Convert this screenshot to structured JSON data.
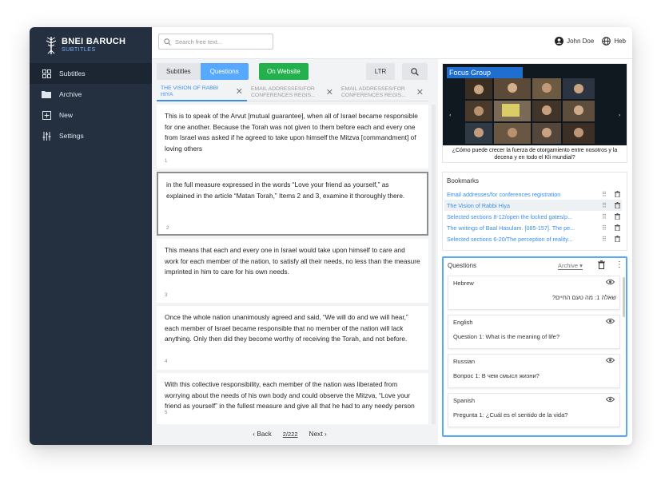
{
  "brand": {
    "name": "BNEI BARUCH",
    "sub": "SUBTITLES"
  },
  "nav": [
    {
      "label": "Subtitles",
      "icon": "grid-icon"
    },
    {
      "label": "Archive",
      "icon": "folder-icon"
    },
    {
      "label": "New",
      "icon": "add-box-icon"
    },
    {
      "label": "Settings",
      "icon": "sliders-icon"
    }
  ],
  "topbar": {
    "search_placeholder": "Search free text...",
    "user": "John Doe",
    "language": "Heb"
  },
  "toolbar": {
    "subtitles": "Subtitles",
    "questions": "Questions",
    "website": "On Website",
    "ltr": "LTR"
  },
  "tabs": [
    {
      "label": "THE VISION OF RABBI HIYA"
    },
    {
      "label": "EMAIL ADDRESSES/FOR CONFERENCES REGIS..."
    },
    {
      "label": "EMAIL ADDRESSES/FOR CONFERENCES REGIS..."
    }
  ],
  "cards": [
    {
      "text": "This is to speak of the Arvut [mutual guarantee], when all of Israel became responsible for one another. Because the Torah was not given to them before each and every one from Israel was asked if he agreed to take upon himself the Mitzva [commandment] of loving others",
      "num": "1"
    },
    {
      "text": "in the full measure expressed in the words “Love your friend as yourself,” as explained in the article “Matan Torah,” Items 2 and 3, examine it thoroughly there.",
      "num": "2"
    },
    {
      "text": "This means that each and every one in Israel would take upon himself to care and work for each member of the nation, to satisfy all their needs, no less than the measure imprinted in him to care for his own needs.",
      "num": "3"
    },
    {
      "text": "Once the whole nation unanimously agreed and said, “We will do and we will hear,” each member of Israel became responsible that no member of the nation will lack anything. Only then did they become worthy of receiving the Torah, and not before.",
      "num": "4"
    },
    {
      "text": "With this collective responsibility, each member of the nation was liberated from worrying about the needs of his own body and could observe the Mitzva, “Love your friend as yourself” in the fullest measure and give all that he had to any needy person",
      "num": "5"
    }
  ],
  "pager": {
    "back": "‹ Back",
    "page": "2/222",
    "next": "Next ›"
  },
  "video": {
    "title": "Focus Group",
    "caption": "¿Cómo puede crecer la fuerza de otorgamiento entre nosotros y la decena y en todo el Kli mundial?"
  },
  "bookmarks": {
    "title": "Bookmarks",
    "items": [
      {
        "label": "Email addresses/for conferences registration"
      },
      {
        "label": "The Vision of Rabbi Hiya"
      },
      {
        "label": "Selected sections 8-12/open the locked gates/p..."
      },
      {
        "label": "The writings of Baal Hasulam. [085-157]. The pe..."
      },
      {
        "label": "Selected sections 6-20/The perception of reality..."
      }
    ]
  },
  "questions": {
    "title": "Questions",
    "archive": "Archive",
    "items": [
      {
        "lang": "Hebrew",
        "text": "שאלה 1: מה טעם החיים?"
      },
      {
        "lang": "English",
        "text": "Question 1: What is the meaning of life?"
      },
      {
        "lang": "Russian",
        "text": "Вопрос 1: В чем смысл жизни?"
      },
      {
        "lang": "Spanish",
        "text": "Pregunta 1: ¿Cuál es el sentido de la vida?"
      }
    ]
  },
  "colors": {
    "sidebar": "#243040",
    "accent": "#57a8ff",
    "website": "#23b14d",
    "link": "#3a8ee6"
  }
}
